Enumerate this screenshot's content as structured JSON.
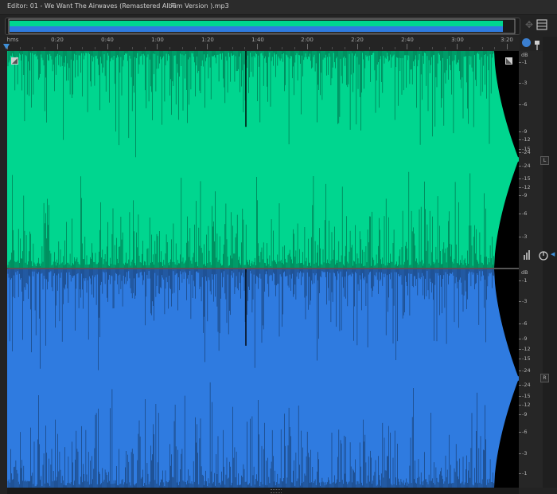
{
  "editor": {
    "title": "Editor: 01 - We Want The Airwaves (Remastered Album Version ).mp3"
  },
  "icons": {
    "panel_menu": "panel-menu-icon",
    "zoom_navigator": "zoom-navigator-icon",
    "snap": "snap-icon",
    "pin": "pin-icon",
    "zoom_corner": "zoom-corner-icon",
    "meter": "meter-icon",
    "power": "power-icon"
  },
  "timeline": {
    "unit_label": "hms",
    "ticks": [
      "0:20",
      "0:40",
      "1:00",
      "1:20",
      "1:40",
      "2:00",
      "2:20",
      "2:40",
      "3:00",
      "3:20"
    ]
  },
  "channels": {
    "left": {
      "badge": "L",
      "color": "#00d68f",
      "db_unit": "dB",
      "db_labels": [
        "-1",
        "-3",
        "-6",
        "-9",
        "-12",
        "-15",
        "-24",
        "-24",
        "-15",
        "-12",
        "-9",
        "-6",
        "-3"
      ]
    },
    "right": {
      "badge": "R",
      "color": "#2f7be0",
      "db_unit": "dB",
      "db_labels": [
        "-1",
        "-3",
        "-6",
        "-9",
        "-12",
        "-15",
        "-24",
        "-24",
        "-15",
        "-12",
        "-9",
        "-6",
        "-3",
        "-1"
      ]
    }
  },
  "colors": {
    "background": "#232323",
    "accent": "#3f8fd8",
    "waveform_left": "#00d68f",
    "waveform_right": "#2f7be0"
  }
}
